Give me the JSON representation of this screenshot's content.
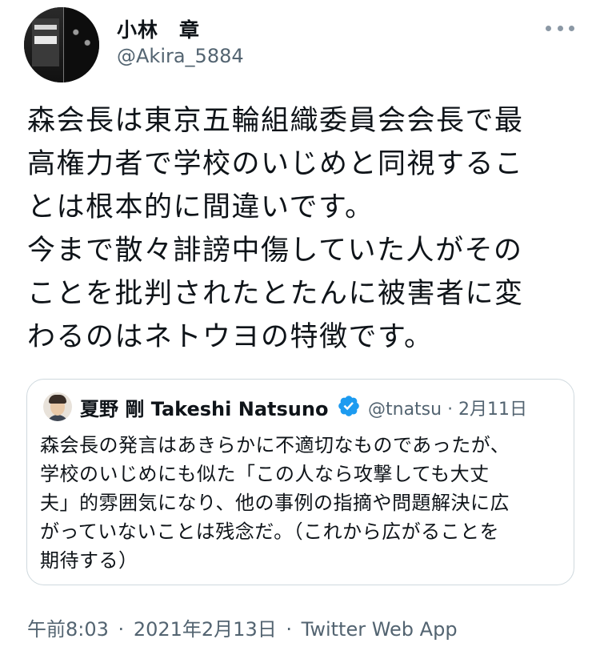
{
  "author": {
    "display_name": "小林　章",
    "handle": "@Akira_5884"
  },
  "tweet": {
    "text_lines": [
      "森会長は東京五輪組織委員会会長で最",
      "高権力者で学校のいじめと同視するこ",
      "とは根本的に間違いです。",
      "今まで散々誹謗中傷していた人がその",
      "ことを批判されたとたんに被害者に変",
      "わるのはネトウヨの特徴です。"
    ]
  },
  "quoted_tweet": {
    "author_name": "夏野 剛 Takeshi Natsuno",
    "handle_date": "@tnatsu · 2月11日",
    "verified": true,
    "text_lines": [
      "森会長の発言はあきらかに不適切なものであったが、",
      "学校のいじめにも似た「この人なら攻撃しても大丈",
      "夫」的雰囲気になり、他の事例の指摘や問題解決に広",
      "がっていないことは残念だ。（これから広がることを",
      "期待する）"
    ]
  },
  "meta": {
    "time": "午前8:03",
    "date": "2021年2月13日",
    "separator": "·",
    "client": "Twitter Web App"
  },
  "colors": {
    "text": "#0f1419",
    "secondary": "#536471",
    "verified": "#1d9bf0",
    "border": "#cfd9de"
  },
  "icons": {
    "more": "more-horizontal-icon",
    "verified": "verified-badge-icon"
  }
}
